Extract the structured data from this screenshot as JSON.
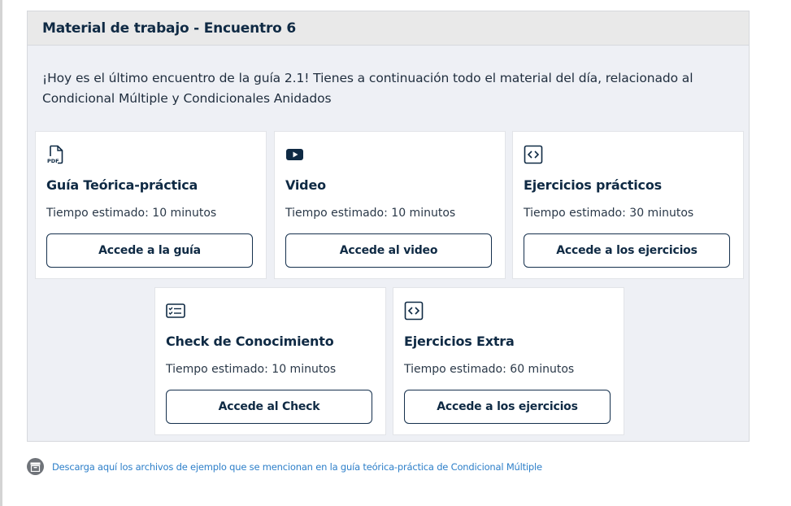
{
  "panel": {
    "title": "Material de trabajo - Encuentro 6",
    "intro": "¡Hoy es el último encuentro de la guía 2.1! Tienes a continuación todo el material del día, relacionado al Condicional Múltiple y Condicionales Anidados"
  },
  "cards": [
    {
      "icon": "pdf-icon",
      "title": "Guía Teórica-práctica",
      "time": "Tiempo estimado: 10 minutos",
      "button": "Accede a la guía"
    },
    {
      "icon": "video-play-icon",
      "title": "Video",
      "time": "Tiempo estimado: 10 minutos",
      "button": "Accede al video"
    },
    {
      "icon": "code-icon",
      "title": "Ejercicios prácticos",
      "time": "Tiempo estimado: 30 minutos",
      "button": "Accede a los ejercicios"
    },
    {
      "icon": "checklist-icon",
      "title": "Check de Conocimiento",
      "time": "Tiempo estimado: 10 minutos",
      "button": "Accede al Check"
    },
    {
      "icon": "code-icon",
      "title": "Ejercicios Extra",
      "time": "Tiempo estimado: 60 minutos",
      "button": "Accede a los ejercicios"
    }
  ],
  "download": {
    "icon": "archive-icon",
    "label": "Descarga aquí los archivos de ejemplo que se mencionan en la guía teórica-práctica de Condicional Múltiple"
  },
  "colors": {
    "panel_bg": "#eef0f5",
    "header_bg": "#e9e9e9",
    "title_text": "#0f2a44",
    "link": "#2d7fc9"
  }
}
